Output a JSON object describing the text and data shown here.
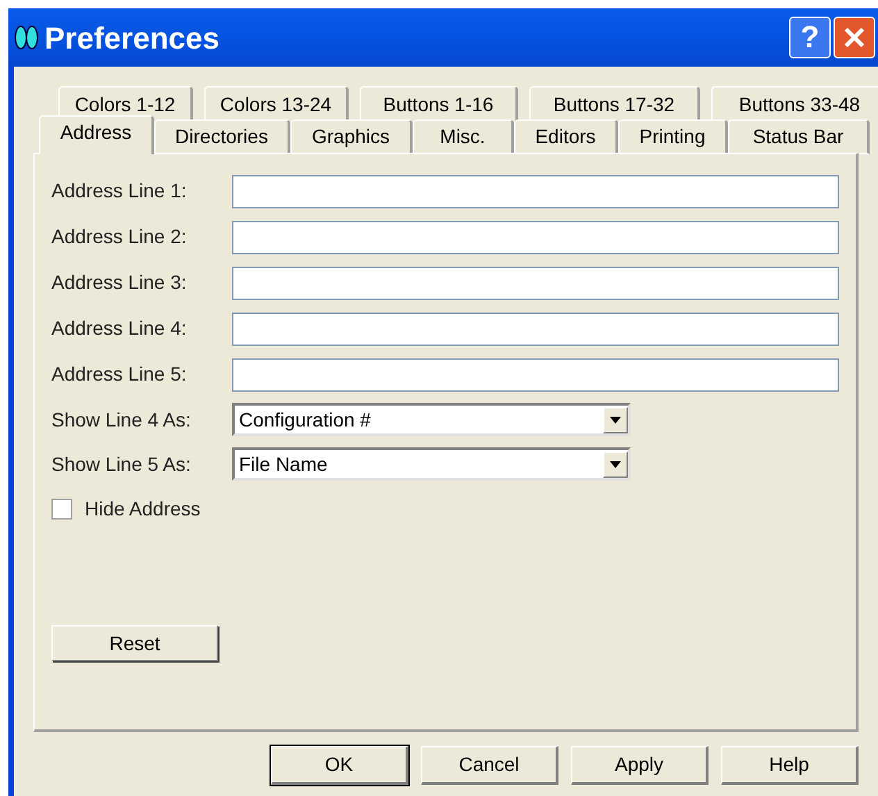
{
  "window": {
    "title": "Preferences",
    "title_buttons": [
      {
        "kind": "help",
        "label": "?"
      },
      {
        "kind": "close"
      }
    ]
  },
  "tab_rows": [
    [
      {
        "label": "Colors 1-12",
        "selected": false
      },
      {
        "label": "Colors 13-24",
        "selected": false
      },
      {
        "label": "Buttons 1-16",
        "selected": false
      },
      {
        "label": "Buttons 17-32",
        "selected": false
      },
      {
        "label": "Buttons 33-48",
        "selected": false
      }
    ],
    [
      {
        "label": "Address",
        "selected": true
      },
      {
        "label": "Directories",
        "selected": false
      },
      {
        "label": "Graphics",
        "selected": false
      },
      {
        "label": "Misc.",
        "selected": false
      },
      {
        "label": "Editors",
        "selected": false
      },
      {
        "label": "Printing",
        "selected": false
      },
      {
        "label": "Status Bar",
        "selected": false
      }
    ]
  ],
  "address_lines": [
    {
      "label": "Address Line 1:"
    },
    {
      "label": "Address Line 2:"
    },
    {
      "label": "Address Line 3:"
    },
    {
      "label": "Address Line 4:"
    },
    {
      "label": "Address Line 5:"
    }
  ],
  "dropdowns": [
    {
      "label": "Show Line 4 As:",
      "value": "Configuration #"
    },
    {
      "label": "Show Line 5 As:",
      "value": "File Name"
    }
  ],
  "hide_address": {
    "label": "Hide Address",
    "checked": false
  },
  "reset_button": "Reset",
  "buttons": [
    {
      "label": "OK",
      "default": true
    },
    {
      "label": "Cancel",
      "default": false
    },
    {
      "label": "Apply",
      "default": false
    },
    {
      "label": "Help",
      "default": false
    }
  ]
}
